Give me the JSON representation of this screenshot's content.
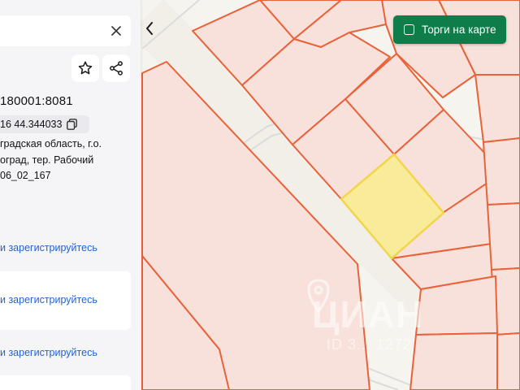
{
  "panel": {
    "cadastral_number": "180001:8081",
    "coordinates": "16 44.344033",
    "address_lines": [
      "градская область, г.о.",
      "оград, тер. Рабочий",
      "06_02_167"
    ],
    "login_prompt": "и зарегистрируйтесь",
    "icons": {
      "close": "close-icon",
      "favorite": "star-icon",
      "share": "share-icon",
      "copy": "copy-icon"
    }
  },
  "map": {
    "collapse_icon": "chevron-left-icon",
    "tenders_toggle": {
      "label": "Торги на карте",
      "checked": false
    },
    "watermark": {
      "brand": "ЦИАН",
      "id_text": "ID 3... 1272"
    },
    "colors": {
      "parcel_fill": "#f8e1db",
      "parcel_stroke": "#e8623a",
      "selected_fill": "#f8ec9a",
      "selected_stroke": "#f2d54b",
      "tenders_bg": "#0e7d4a",
      "link": "#1f63d8"
    }
  }
}
